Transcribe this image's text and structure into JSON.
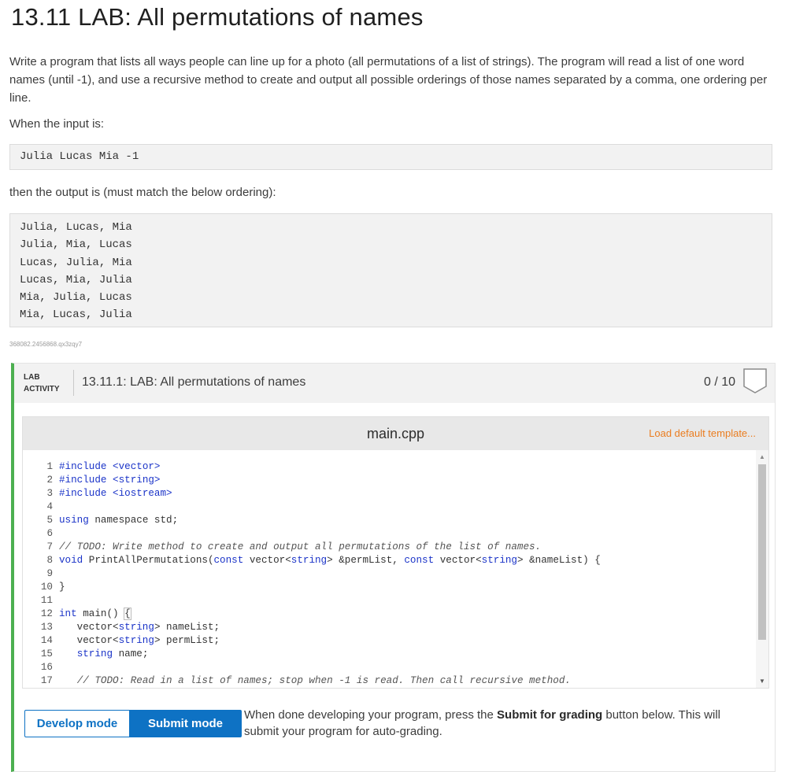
{
  "title": "13.11 LAB: All permutations of names",
  "description": "Write a program that lists all ways people can line up for a photo (all permutations of a list of strings). The program will read a list of one word names (until -1), and use a recursive method to create and output all possible orderings of those names separated by a comma, one ordering per line.",
  "input_intro": "When the input is:",
  "input_example": "Julia Lucas Mia -1",
  "output_intro": "then the output is (must match the below ordering):",
  "output_example": [
    "Julia, Lucas, Mia",
    "Julia, Mia, Lucas",
    "Lucas, Julia, Mia",
    "Lucas, Mia, Julia",
    "Mia, Julia, Lucas",
    "Mia, Lucas, Julia"
  ],
  "tracking_id": "368082.2456868.qx3zqy7",
  "lab": {
    "tag_line1": "LAB",
    "tag_line2": "ACTIVITY",
    "title": "13.11.1: LAB: All permutations of names",
    "score": "0 / 10"
  },
  "editor": {
    "filename": "main.cpp",
    "load_template": "Load default template...",
    "line_numbers": [
      "1",
      "2",
      "3",
      "4",
      "5",
      "6",
      "7",
      "8",
      "9",
      "10",
      "11",
      "12",
      "13",
      "14",
      "15",
      "16",
      "17"
    ]
  },
  "modes": {
    "develop": "Develop mode",
    "submit": "Submit mode",
    "note_prefix": "When done developing your program, press the ",
    "note_bold": "Submit for grading",
    "note_suffix": " button below. This will submit your program for auto-grading."
  },
  "colors": {
    "accent_blue": "#0e72c4",
    "lab_green": "#4caf50",
    "link_orange": "#ea7d20"
  }
}
